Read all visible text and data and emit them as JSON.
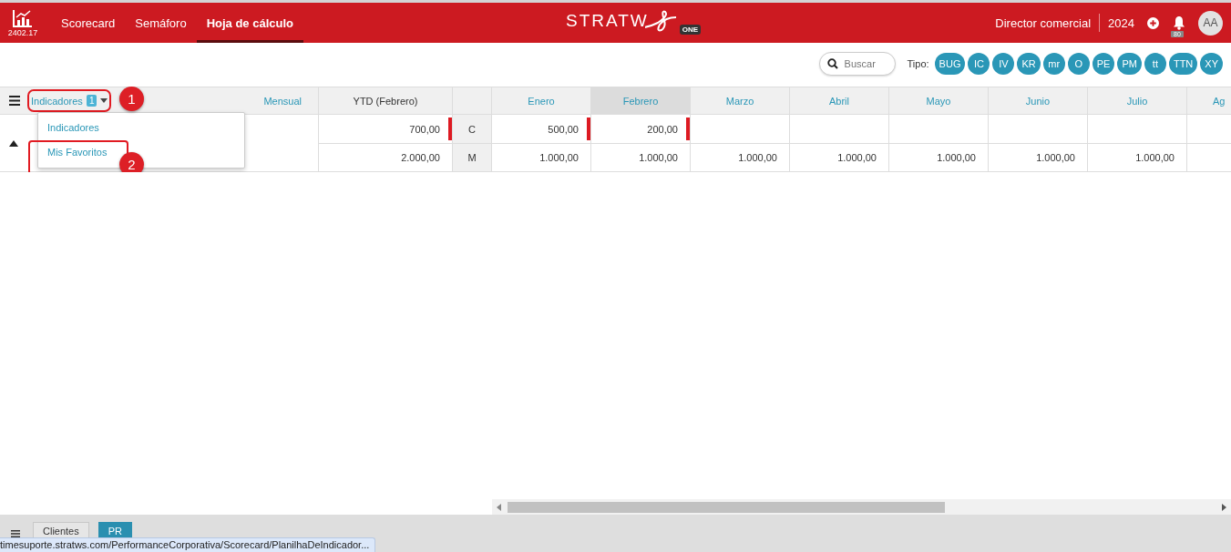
{
  "header": {
    "version": "2402.17",
    "nav": [
      {
        "label": "Scorecard",
        "selected": false
      },
      {
        "label": "Semáforo",
        "selected": false
      },
      {
        "label": "Hoja de cálculo",
        "selected": true
      }
    ],
    "logo": {
      "text": "STRATW",
      "badge": "ONE"
    },
    "role": "Director comercial",
    "year": "2024",
    "notifications": "80",
    "avatar": "AA"
  },
  "toolbar": {
    "search": {
      "placeholder": "Buscar"
    },
    "type_label": "Tipo:",
    "types": [
      "BUG",
      "IC",
      "IV",
      "KR",
      "mr",
      "O",
      "PE",
      "PM",
      "tt",
      "TTN",
      "XY"
    ]
  },
  "grid": {
    "selector": {
      "label": "Indicadores",
      "count": "1"
    },
    "period": "Mensual",
    "ytd_header": "YTD (Febrero)",
    "months": [
      {
        "label": "Enero",
        "selected": false
      },
      {
        "label": "Febrero",
        "selected": true
      },
      {
        "label": "Marzo",
        "selected": false
      },
      {
        "label": "Abril",
        "selected": false
      },
      {
        "label": "Mayo",
        "selected": false
      },
      {
        "label": "Junio",
        "selected": false
      },
      {
        "label": "Julio",
        "selected": false
      },
      {
        "label": "Ag",
        "selected": false
      }
    ],
    "rows": [
      {
        "ytd": "700,00",
        "ytd_alert": true,
        "code": "C",
        "values": [
          {
            "text": "500,00",
            "alert": true
          },
          {
            "text": "200,00",
            "alert": true
          }
        ]
      },
      {
        "ytd": "2.000,00",
        "ytd_alert": false,
        "code": "M",
        "values": [
          {
            "text": "1.000,00",
            "alert": false
          },
          {
            "text": "1.000,00",
            "alert": false
          },
          {
            "text": "1.000,00",
            "alert": false
          },
          {
            "text": "1.000,00",
            "alert": false
          },
          {
            "text": "1.000,00",
            "alert": false
          },
          {
            "text": "1.000,00",
            "alert": false
          },
          {
            "text": "1.000,00",
            "alert": false
          }
        ]
      }
    ]
  },
  "dropdown": {
    "items": [
      "Indicadores",
      "Mis Favoritos"
    ]
  },
  "callouts": [
    {
      "number": "1"
    },
    {
      "number": "2"
    }
  ],
  "bottom": {
    "tabs": [
      {
        "label": "Clientes",
        "selected": false
      },
      {
        "label": "PR",
        "selected": true
      }
    ]
  },
  "status_url": "timesuporte.stratws.com/PerformanceCorporativa/Scorecard/PlanilhaDeIndicador..."
}
